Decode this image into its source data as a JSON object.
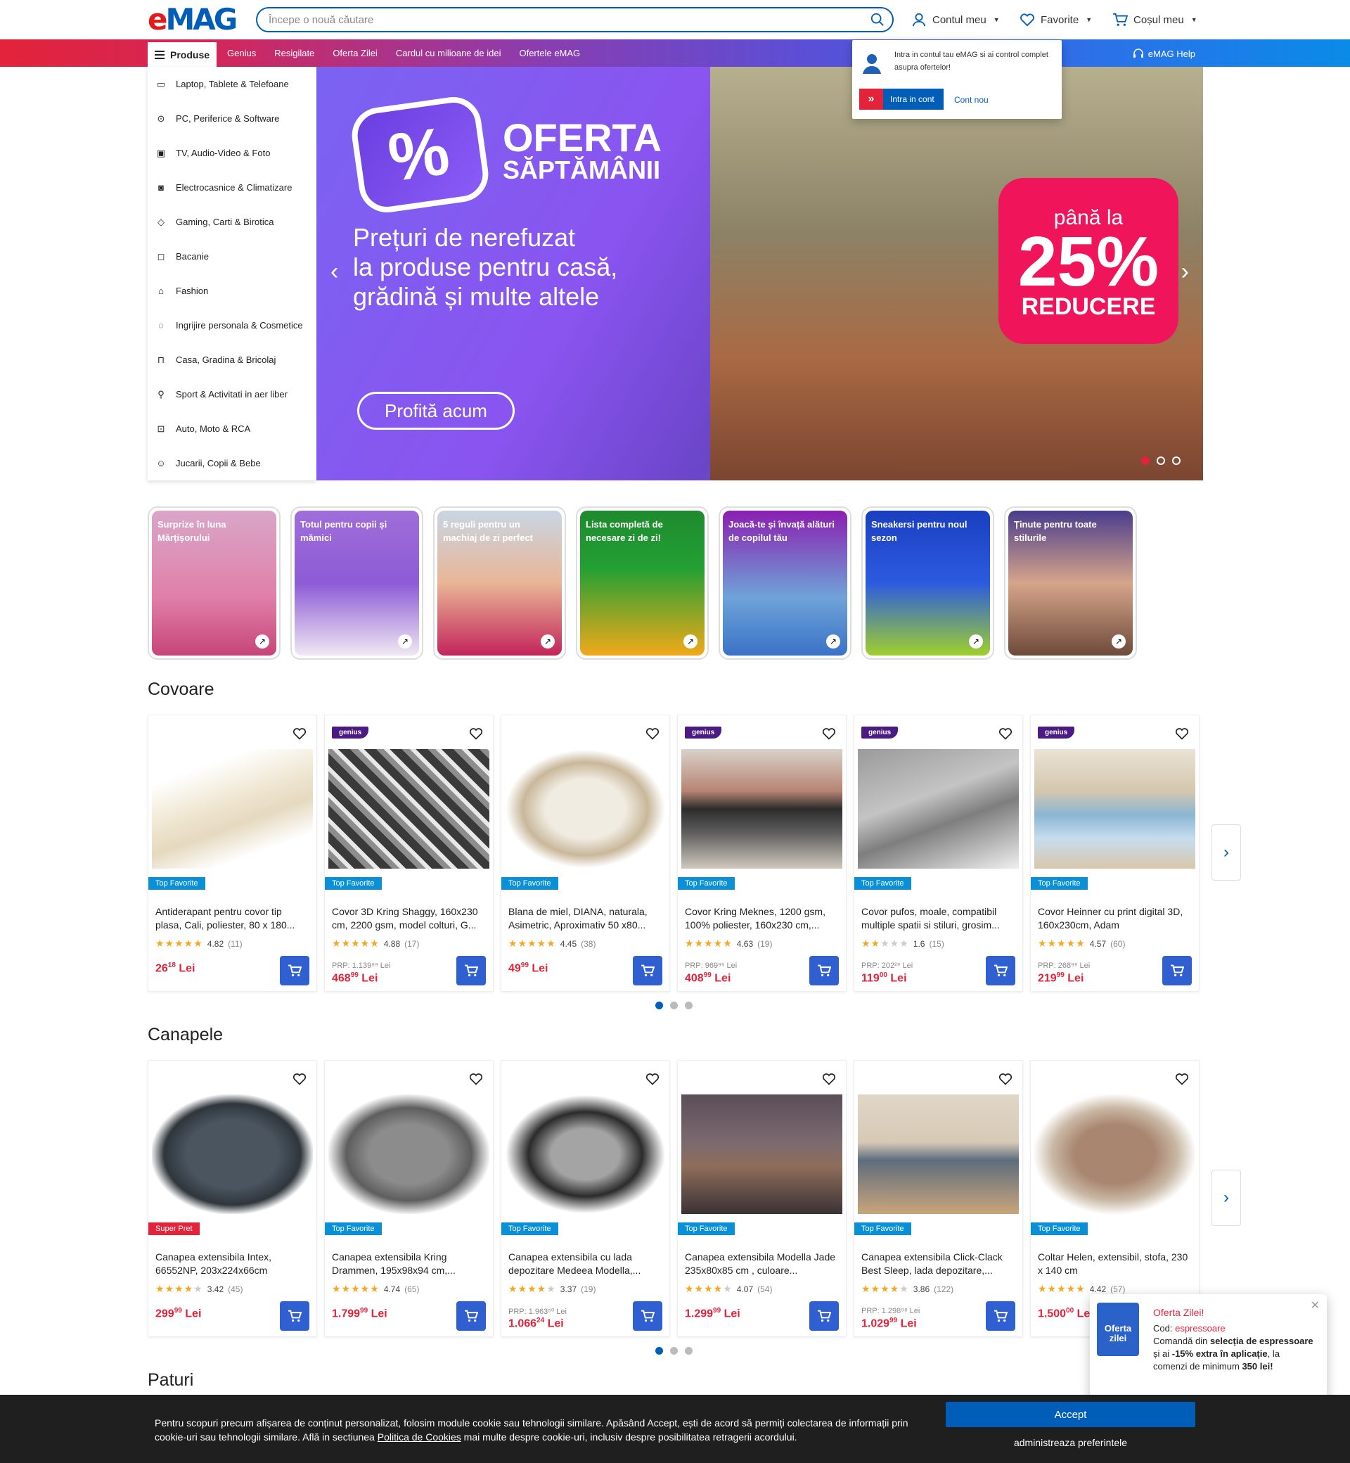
{
  "header": {
    "logo_e": "e",
    "logo_mag": "MAG",
    "search_placeholder": "Începe o nouă căutare",
    "account": "Contul meu",
    "favorites": "Favorite",
    "cart": "Coșul meu"
  },
  "nav": {
    "produse": "Produse",
    "items": [
      "Genius",
      "Resigilate",
      "Oferta Zilei",
      "Cardul cu milioane de idei",
      "Ofertele eMAG"
    ],
    "help": "eMAG Help"
  },
  "account_popover": {
    "message": "Intra in contul tau eMAG si ai control complet asupra ofertelor!",
    "login": "Intra in cont",
    "new_account": "Cont nou"
  },
  "sidebar": {
    "items": [
      {
        "label": "Laptop, Tablete & Telefoane",
        "icon": "laptop-icon"
      },
      {
        "label": "PC, Periferice & Software",
        "icon": "mouse-icon"
      },
      {
        "label": "TV, Audio-Video & Foto",
        "icon": "tv-icon"
      },
      {
        "label": "Electrocasnice & Climatizare",
        "icon": "washer-icon"
      },
      {
        "label": "Gaming, Carti & Birotica",
        "icon": "gamepad-icon"
      },
      {
        "label": "Bacanie",
        "icon": "bag-icon"
      },
      {
        "label": "Fashion",
        "icon": "shirt-icon"
      },
      {
        "label": "Ingrijire personala & Cosmetice",
        "icon": "cosmetics-icon"
      },
      {
        "label": "Casa, Gradina & Bricolaj",
        "icon": "sofa-icon"
      },
      {
        "label": "Sport & Activitati in aer liber",
        "icon": "racket-icon"
      },
      {
        "label": "Auto, Moto & RCA",
        "icon": "car-icon"
      },
      {
        "label": "Jucarii, Copii & Bebe",
        "icon": "toy-icon"
      }
    ]
  },
  "banner": {
    "title_1": "OFERTA",
    "title_2": "SĂPTĂMÂNII",
    "text_1": "Prețuri de nerefuzat",
    "text_2": "la produse pentru casă,",
    "text_3": "grădină și multe altele",
    "cta": "Profită acum",
    "discount_1": "până la",
    "discount_2": "25%",
    "discount_3": "REDUCERE",
    "pct_symbol": "%",
    "slides": 3,
    "active_slide": 1
  },
  "stories": [
    {
      "caption": "Surprize în luna Mărțișorului",
      "bg": "linear-gradient(180deg,#d9a6c8 0%,#e07fa8 60%,#c74579 100%)"
    },
    {
      "caption": "Totul pentru copii și mămici",
      "bg": "linear-gradient(180deg,#a06ed8 0%,#8d5bd6 50%,#f0e8f3 100%)"
    },
    {
      "caption": "5 reguli pentru un machiaj de zi perfect",
      "bg": "linear-gradient(180deg,#c8d6e4 0%,#e9b596 50%,#c2245a 100%)"
    },
    {
      "caption": "Lista completă de necesare zi de zi!",
      "bg": "linear-gradient(180deg,#1e8a2e 0%,#23a034 40%,#f2a91a 100%)"
    },
    {
      "caption": "Joacă-te și învață alături de copilul tău",
      "bg": "linear-gradient(180deg,#8a1fb0 0%,#6fa3d8 60%,#3a72c8 100%)"
    },
    {
      "caption": "Sneakersi pentru noul sezon",
      "bg": "linear-gradient(180deg,#1a3fc0 0%,#2c5be0 50%,#9fd02c 100%)"
    },
    {
      "caption": "Ținute pentru toate stilurile",
      "bg": "linear-gradient(180deg,#4a3c8c 0%,#d6a58a 50%,#6e4a3a 100%)"
    }
  ],
  "section_covoare": {
    "title": "Covoare",
    "products": [
      {
        "title": "Antiderapant pentru covor tip plasa, Cali, poliester, 80 x 180...",
        "rating": "4.82",
        "count": "(11)",
        "stars": 5,
        "badge": "Top Favorite",
        "badge_red": false,
        "genius": false,
        "prp": "",
        "price_int": "26",
        "price_dec": "18",
        "currency": "Lei",
        "img": "linear-gradient(160deg,#fff 20%,#efe6d1 45%,#e5d9bf 60%,#fff 80%)"
      },
      {
        "title": "Covor 3D Kring Shaggy, 160x230 cm, 2200 gsm, model colturi, G...",
        "rating": "4.88",
        "count": "(17)",
        "stars": 5,
        "badge": "Top Favorite",
        "badge_red": false,
        "genius": true,
        "prp": "PRP: 1.139⁹⁹ Lei",
        "price_int": "468",
        "price_dec": "99",
        "currency": "Lei",
        "img": "repeating-linear-gradient(45deg,#3a3a3a 0 12px,#8d8d8d 12px 20px,#e8e8e8 20px 26px)"
      },
      {
        "title": "Blana de miel, DIANA, naturala, Asimetric, Aproximativ 50 x80...",
        "rating": "4.45",
        "count": "(38)",
        "stars": 4.5,
        "badge": "Top Favorite",
        "badge_red": false,
        "genius": false,
        "prp": "",
        "price_int": "49",
        "price_dec": "99",
        "currency": "Lei",
        "img": "radial-gradient(ellipse at center,#f0ece2 35%,#c9b79a 55%,#fff 70%)"
      },
      {
        "title": "Covor Kring Meknes, 1200 gsm, 100% poliester, 160x230 cm,...",
        "rating": "4.63",
        "count": "(19)",
        "stars": 5,
        "badge": "Top Favorite",
        "badge_red": false,
        "genius": true,
        "prp": "PRP: 969⁹⁹ Lei",
        "price_int": "408",
        "price_dec": "99",
        "currency": "Lei",
        "img": "linear-gradient(180deg,#d8d2ca 0%,#b78473 35%,#2c2c2c 50%,#5e5e5e 70%,#cfc8bd 100%)"
      },
      {
        "title": "Covor pufos, moale, compatibil multiple spatii si stiluri, grosim...",
        "rating": "1.6",
        "count": "(15)",
        "stars": 1.5,
        "badge": "Top Favorite",
        "badge_red": false,
        "genius": true,
        "prp": "PRP: 202²⁹ Lei",
        "price_int": "119",
        "price_dec": "00",
        "currency": "Lei",
        "img": "linear-gradient(160deg,#9a9a9a 0%,#c4c4c4 40%,#7e7e7e 60%,#efefef 100%)"
      },
      {
        "title": "Covor Heinner cu print digital 3D, 160x230cm, Adam",
        "rating": "4.57",
        "count": "(60)",
        "stars": 4.5,
        "badge": "Top Favorite",
        "badge_red": false,
        "genius": true,
        "prp": "PRP: 268⁹⁹ Lei",
        "price_int": "219",
        "price_dec": "99",
        "currency": "Lei",
        "img": "linear-gradient(180deg,#e9e2d6 0%,#d5c7ad 35%,#8bb6d3 55%,#c7dced 75%,#d9c7ab 100%)"
      }
    ]
  },
  "section_canapele": {
    "title": "Canapele",
    "products": [
      {
        "title": "Canapea extensibila Intex, 66552NP, 203x224x66cm",
        "rating": "3.42",
        "count": "(45)",
        "stars": 3.5,
        "badge": "Super Pret",
        "badge_red": true,
        "genius": false,
        "prp": "",
        "price_int": "299",
        "price_dec": "99",
        "currency": "Lei",
        "img": "radial-gradient(ellipse at center,#4a5560 40%,#2f363c 60%,#fff 72%)"
      },
      {
        "title": "Canapea extensibila Kring Drammen, 195x98x94 cm,...",
        "rating": "4.74",
        "count": "(65)",
        "stars": 5,
        "badge": "Top Favorite",
        "badge_red": false,
        "genius": false,
        "prp": "",
        "price_int": "1.799",
        "price_dec": "99",
        "currency": "Lei",
        "img": "radial-gradient(ellipse at center,#8c8c8c 35%,#5e5e5e 55%,#fff 72%)"
      },
      {
        "title": "Canapea extensibila cu lada depozitare Medeea Modella,...",
        "rating": "3.37",
        "count": "(19)",
        "stars": 3.5,
        "badge": "Top Favorite",
        "badge_red": false,
        "genius": false,
        "prp": "PRP: 1.963⁵⁰ Lei",
        "price_int": "1.066",
        "price_dec": "24",
        "currency": "Lei",
        "img": "radial-gradient(ellipse at center,#a4a4a4 30%,#2b2b2b 50%,#fff 70%)"
      },
      {
        "title": "Canapea extensibila Modella Jade 235x80x85 cm , culoare...",
        "rating": "4.07",
        "count": "(54)",
        "stars": 4,
        "badge": "Top Favorite",
        "badge_red": false,
        "genius": false,
        "prp": "",
        "price_int": "1.299",
        "price_dec": "99",
        "currency": "Lei",
        "img": "linear-gradient(180deg,#5b4e57 0%,#7b6a70 40%,#8f6d5a 60%,#3a3236 100%)"
      },
      {
        "title": "Canapea extensibila Click-Clack Best Sleep, lada depozitare,...",
        "rating": "3.86",
        "count": "(122)",
        "stars": 4,
        "badge": "Top Favorite",
        "badge_red": false,
        "genius": false,
        "prp": "PRP: 1.298⁹⁸ Lei",
        "price_int": "1.029",
        "price_dec": "99",
        "currency": "Lei",
        "img": "linear-gradient(180deg,#e0d7c9 0%,#d6cab5 40%,#5e6c7d 55%,#c9a57b 100%)"
      },
      {
        "title": "Coltar Helen, extensibil, stofa, 230 x 140 cm",
        "rating": "4.42",
        "count": "(57)",
        "stars": 4.5,
        "badge": "Top Favorite",
        "badge_red": false,
        "genius": false,
        "prp": "",
        "price_int": "1.500",
        "price_dec": "00",
        "currency": "Lei",
        "img": "radial-gradient(ellipse at center,#a98670 35%,#c9b8a5 55%,#fff 72%)"
      }
    ]
  },
  "section_paturi": {
    "title": "Paturi"
  },
  "toast": {
    "icon_text": "Oferta zilei",
    "title": "Oferta Zilei!",
    "code_label": "Cod:",
    "code": "espressoare",
    "line_a": "Comandă din",
    "line_b": "selecția de espressoare",
    "line_c": "și ai",
    "line_d": "-15% extra în aplicație",
    "line_e": ", la comenzi de minimum",
    "line_f": "350 lei!"
  },
  "cookie": {
    "text_a": "Pentru scopuri precum afișarea de conținut personalizat, folosim module cookie sau tehnologii similare. Apăsând Accept, ești de acord să permiți colectarea de informații prin cookie-uri sau tehnologii similare. Află in sectiunea ",
    "link": "Politica de Cookies",
    "text_b": " mai multe despre cookie-uri, inclusiv despre posibilitatea retragerii acordului.",
    "accept": "Accept",
    "manage": "administreaza preferintele"
  },
  "colors": {
    "brand_blue": "#005eb8",
    "brand_red": "#e2233a",
    "genius_purple": "#4b1a83",
    "top_fav": "#0a90d8"
  }
}
